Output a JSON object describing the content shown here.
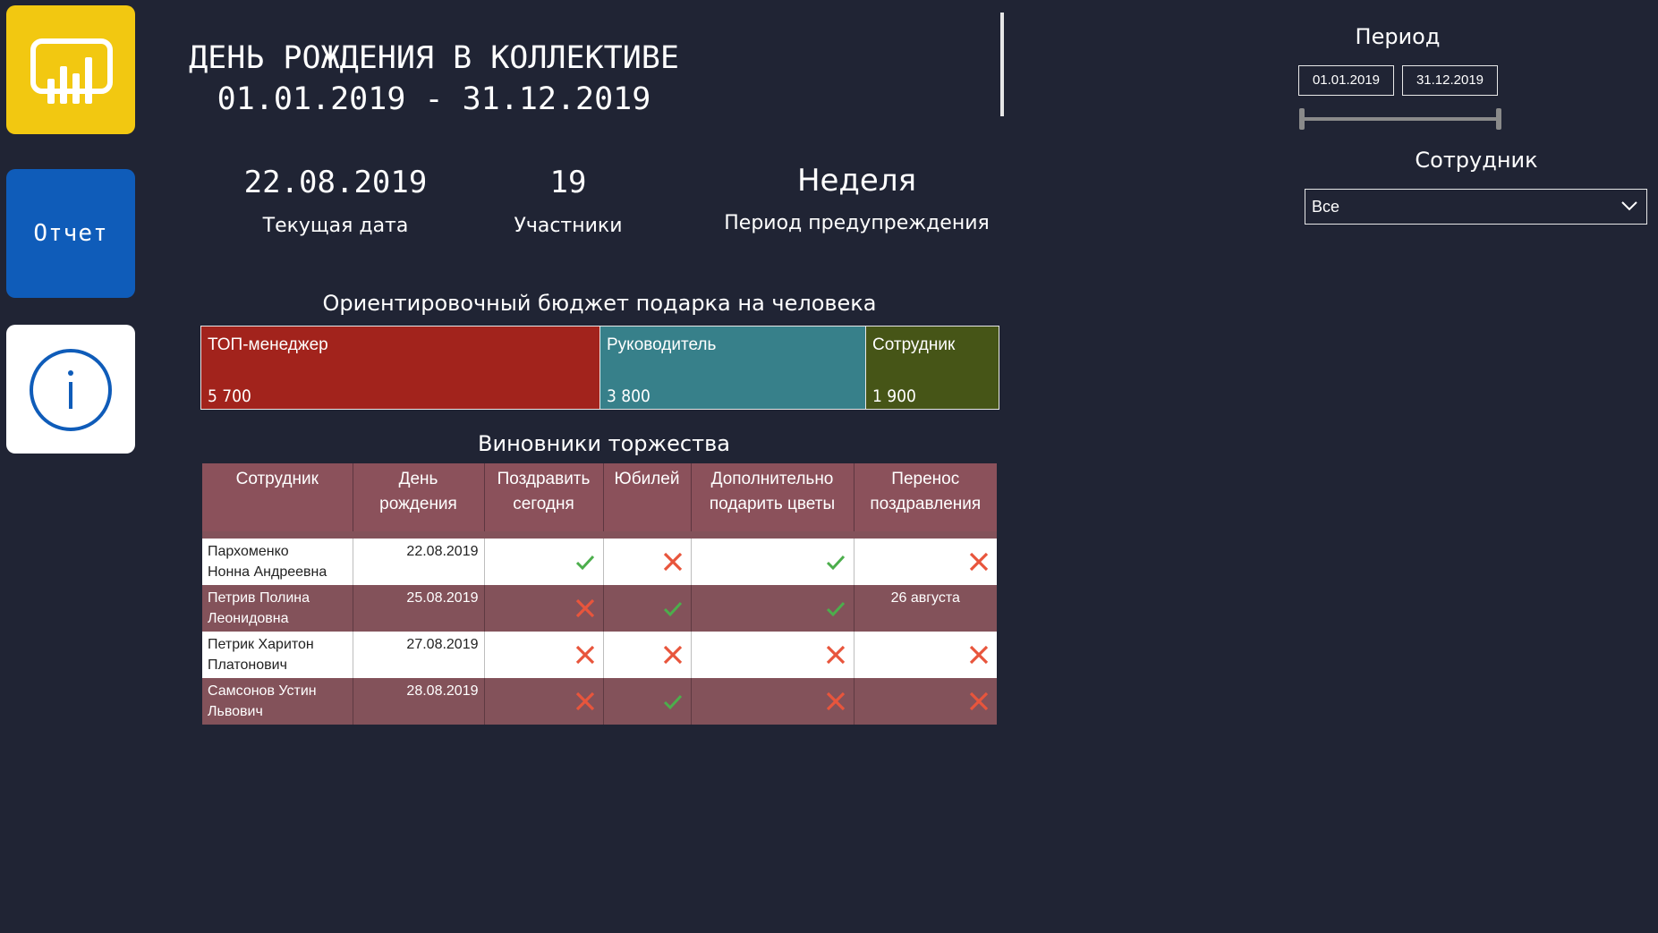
{
  "nav": {
    "report_label": "Отчет"
  },
  "header": {
    "title_line1": "ДЕНЬ РОЖДЕНИЯ В КОЛЛЕКТИВЕ",
    "title_line2": "01.01.2019 - 31.12.2019"
  },
  "kpis": [
    {
      "value": "22.08.2019",
      "label": "Текущая дата"
    },
    {
      "value": "19",
      "label": "Участники"
    },
    {
      "value": "Неделя",
      "label": "Период предупреждения"
    }
  ],
  "budget": {
    "title": "Ориентировочный бюджет подарка на человека",
    "items": [
      {
        "name": "ТОП-менеджер",
        "value": "5 700",
        "color": "#a2231c"
      },
      {
        "name": "Руководитель",
        "value": "3 800",
        "color": "#37808a"
      },
      {
        "name": "Сотрудник",
        "value": "1 900",
        "color": "#465517"
      }
    ]
  },
  "table": {
    "title": "Виновники торжества",
    "headers": [
      {
        "line1": "Сотрудник",
        "line2": ""
      },
      {
        "line1": "День",
        "line2": "рождения"
      },
      {
        "line1": "Поздравить",
        "line2": "сегодня"
      },
      {
        "line1": "Юбилей",
        "line2": ""
      },
      {
        "line1": "Дополнительно",
        "line2": "подарить цветы"
      },
      {
        "line1": "Перенос",
        "line2": "поздравления"
      }
    ],
    "rows": [
      {
        "name1": "Пархоменко",
        "name2": "Нонна Андреевна",
        "date": "22.08.2019",
        "today": true,
        "jubilee": false,
        "flowers": true,
        "transfer": "",
        "transfer_flag": false
      },
      {
        "name1": "Петрив Полина",
        "name2": "Леонидовна",
        "date": "25.08.2019",
        "today": false,
        "jubilee": true,
        "flowers": true,
        "transfer": "26 августа",
        "transfer_flag": null
      },
      {
        "name1": "Петрик Харитон",
        "name2": "Платонович",
        "date": "27.08.2019",
        "today": false,
        "jubilee": false,
        "flowers": false,
        "transfer": "",
        "transfer_flag": false
      },
      {
        "name1": "Самсонов Устин",
        "name2": "Львович",
        "date": "28.08.2019",
        "today": false,
        "jubilee": true,
        "flowers": false,
        "transfer": "",
        "transfer_flag": false
      }
    ]
  },
  "filters": {
    "period_title": "Период",
    "date_from": "01.01.2019",
    "date_to": "31.12.2019",
    "employee_title": "Сотрудник",
    "employee_value": "Все"
  },
  "colors": {
    "background": "#202434",
    "ok": "#4cae4c",
    "no": "#e8553c",
    "header": "#8b515b"
  }
}
